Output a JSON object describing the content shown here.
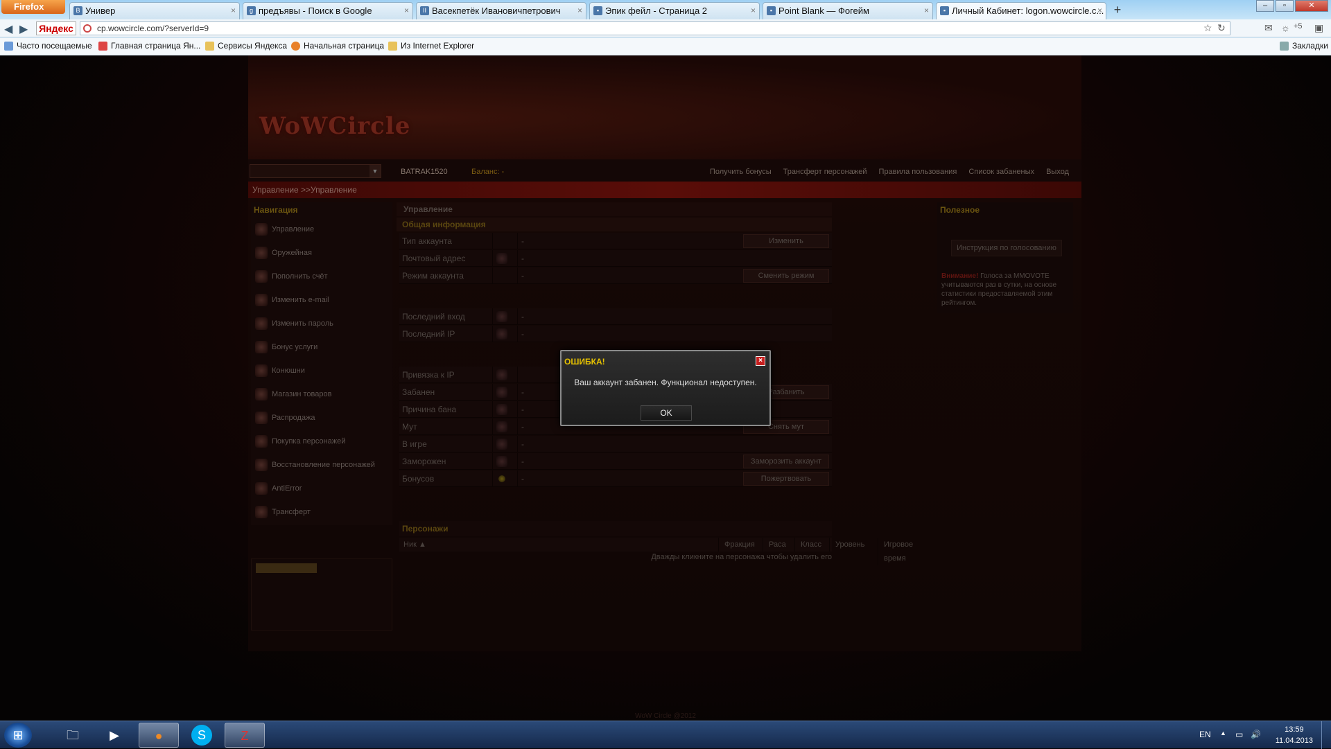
{
  "browser": {
    "menu_label": "Firefox",
    "tabs": [
      {
        "label": "Универ",
        "icon": "В"
      },
      {
        "label": "предъявы - Поиск в Google",
        "icon": "g"
      },
      {
        "label": "Васекпетёк Ивановичпетрович",
        "icon": "II"
      },
      {
        "label": "Эпик фейл - Страница 2",
        "icon": "▪"
      },
      {
        "label": "Point Blank — Фогейм",
        "icon": "▪"
      },
      {
        "label": "Личный Кабинет: logon.wowcircle.c...",
        "icon": "▪"
      }
    ],
    "url": "cp.wowcircle.com/?serverId=9",
    "search_engine": "Яндекс",
    "extension_count": "+5",
    "bookmarks": [
      "Часто посещаемые",
      "Главная страница Ян...",
      "Сервисы Яндекса",
      "Начальная страница",
      "Из Internet Explorer"
    ],
    "bookmarks_right": "Закладки"
  },
  "site": {
    "logo": "WoWCircle",
    "username": "BATRAK1520",
    "balance_label": "Баланс:  -",
    "top_links": [
      "Получить бонусы",
      "Трансферт персонажей",
      "Правила пользования",
      "Список забаненых",
      "Выход"
    ],
    "breadcrumb": "Управление >>Управление",
    "sidebar": {
      "title": "Навигация",
      "items": [
        "Управление",
        "Оружейная",
        "Пополнить счёт",
        "Изменить e-mail",
        "Изменить пароль",
        "Бонус услуги",
        "Конюшни",
        "Магазин товаров",
        "Распродажа",
        "Покупка персонажей",
        "Восстановление персонажей",
        "AntiError",
        "Трансферт"
      ]
    },
    "main": {
      "title": "Управление",
      "section": "Общая информация",
      "rows_group1": [
        {
          "label": "Тип аккаунта",
          "value": "-",
          "button": "Изменить"
        },
        {
          "label": "Почтовый адрес",
          "value": "-",
          "button": ""
        },
        {
          "label": "Режим аккаунта",
          "value": "-",
          "button": "Сменить режим"
        }
      ],
      "rows_group2": [
        {
          "label": "Последний вход",
          "value": "-"
        },
        {
          "label": "Последний IP",
          "value": "-"
        }
      ],
      "rows_group3": [
        {
          "label": "Привязка к IP",
          "value": "",
          "button": ""
        },
        {
          "label": "Забанен",
          "value": "-",
          "button": "Разбанить"
        },
        {
          "label": "Причина бана",
          "value": "-",
          "button": ""
        },
        {
          "label": "Мут",
          "value": "-",
          "button": "Снять мут"
        },
        {
          "label": "В игре",
          "value": "-",
          "button": ""
        },
        {
          "label": "Заморожен",
          "value": "-",
          "button": "Заморозить аккаунт"
        },
        {
          "label": "Бонусов",
          "value": "-",
          "button": "Пожертвовать"
        }
      ],
      "characters_title": "Персонажи",
      "characters_columns": [
        "Ник ▲",
        "Фракция",
        "Раса",
        "Класс",
        "Уровень",
        "Игровое время"
      ],
      "characters_hint": "Дважды кликните на персонажа чтобы удалить его"
    },
    "right": {
      "title": "Полезное",
      "button": "Инструкция по голосованию",
      "warn": "Внимание!",
      "note": " Голоса за MMOVOTE учитываются раз в сутки, на основе статистики предоставляемой этим рейтингом."
    },
    "footer": "WoW Circle @2012"
  },
  "dialog": {
    "title": "ОШИБКА!",
    "message": "Ваш аккаунт забанен. Функционал недоступен.",
    "ok": "OK"
  },
  "taskbar": {
    "language": "EN",
    "time": "13:59",
    "date": "11.04.2013"
  }
}
